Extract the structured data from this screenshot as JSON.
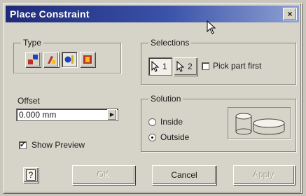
{
  "window": {
    "title": "Place Constraint",
    "close_glyph": "×"
  },
  "type_group": {
    "label": "Type",
    "buttons": [
      {
        "name": "mate-constraint-icon",
        "active": false
      },
      {
        "name": "angle-constraint-icon",
        "active": false
      },
      {
        "name": "tangent-constraint-icon",
        "active": true
      },
      {
        "name": "insert-constraint-icon",
        "active": false
      }
    ]
  },
  "selections_group": {
    "label": "Selections",
    "sel1": "1",
    "sel2": "2",
    "pick_part_first": {
      "label": "Pick part first",
      "checked": false
    }
  },
  "offset": {
    "label": "Offset",
    "value": "0.000 mm"
  },
  "show_preview": {
    "label": "Show Preview",
    "checked": true,
    "mark": "✓"
  },
  "solution_group": {
    "label": "Solution",
    "options": [
      {
        "label": "Inside",
        "selected": false
      },
      {
        "label": "Outside",
        "selected": true
      }
    ]
  },
  "buttons": {
    "help": "?",
    "ok": "OK",
    "cancel": "Cancel",
    "apply": "Apply"
  },
  "colors": {
    "titlebar_start": "#1f2a78",
    "titlebar_end": "#8ea0d4",
    "dialog_bg": "#d6d3c8"
  }
}
